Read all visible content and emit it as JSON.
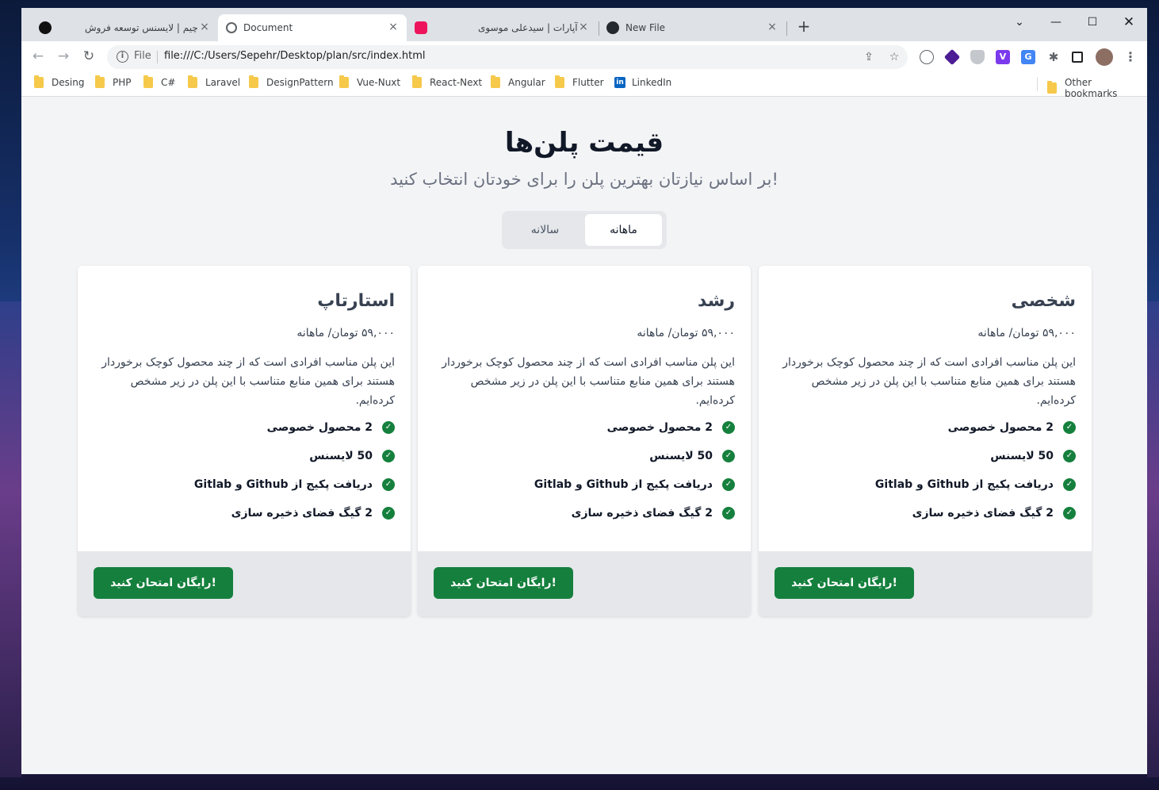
{
  "browser": {
    "tabs": [
      {
        "title": "چیم | لایسنس توسعه فروش",
        "favicon": "app-logo-icon"
      },
      {
        "title": "Document",
        "favicon": "globe-icon",
        "active": true
      },
      {
        "title": "آپارات | سیدعلی موسوی",
        "favicon": "aparat-icon"
      },
      {
        "title": "New File",
        "favicon": "github-icon"
      }
    ],
    "tab_close": "×",
    "new_tab": "+",
    "address": {
      "scheme_label": "File",
      "url": "file:///C:/Users/Sepehr/Desktop/plan/src/index.html"
    },
    "bookmarks": [
      "Desing",
      "PHP",
      "C#",
      "Laravel",
      "DesignPattern",
      "Vue-Nuxt",
      "React-Next",
      "Angular",
      "Flutter",
      "LinkedIn"
    ],
    "other_bookmarks": "Other bookmarks"
  },
  "page": {
    "title": "قیمت پلن‌ها",
    "subtitle": "بر اساس نیازتان بهترین پلن را برای خودتان انتخاب کنید!",
    "toggle": {
      "monthly": "ماهانه",
      "yearly": "سالانه",
      "selected": "monthly"
    },
    "plans": [
      {
        "name": "شخصی",
        "price": "۵۹,۰۰۰ تومان/ ماهانه",
        "description": "این پلن مناسب افرادی است که از چند محصول کوچک برخوردار هستند برای همین منابع متناسب با این پلن در زیر مشخص کرده‌ایم.",
        "features": [
          "2 محصول خصوصی",
          "50 لایسنس",
          "دریافت پکیج از Github و Gitlab",
          "2 گیگ فضای ذخیره سازی"
        ],
        "cta": "رایگان امتحان کنید!"
      },
      {
        "name": "رشد",
        "price": "۵۹,۰۰۰ تومان/ ماهانه",
        "description": "این پلن مناسب افرادی است که از چند محصول کوچک برخوردار هستند برای همین منابع متناسب با این پلن در زیر مشخص کرده‌ایم.",
        "features": [
          "2 محصول خصوصی",
          "50 لایسنس",
          "دریافت پکیج از Github و Gitlab",
          "2 گیگ فضای ذخیره سازی"
        ],
        "cta": "رایگان امتحان کنید!"
      },
      {
        "name": "استارتاپ",
        "price": "۵۹,۰۰۰ تومان/ ماهانه",
        "description": "این پلن مناسب افرادی است که از چند محصول کوچک برخوردار هستند برای همین منابع متناسب با این پلن در زیر مشخص کرده‌ایم.",
        "features": [
          "2 محصول خصوصی",
          "50 لایسنس",
          "دریافت پکیج از Github و Gitlab",
          "2 گیگ فضای ذخیره سازی"
        ],
        "cta": "رایگان امتحان کنید!"
      }
    ]
  },
  "colors": {
    "accent": "#15803d",
    "card_footer": "#e5e7eb",
    "page_bg": "#f3f4f6"
  }
}
